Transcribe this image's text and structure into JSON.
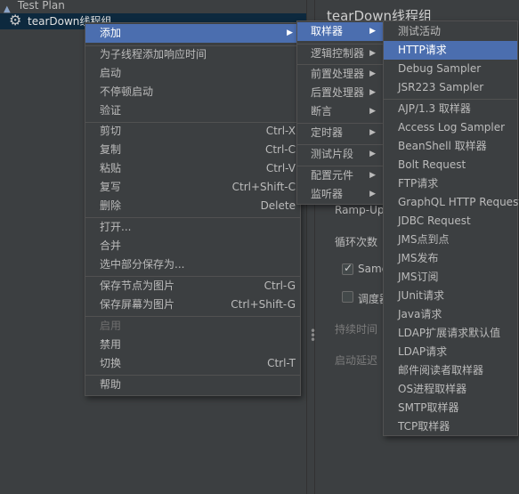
{
  "tree": {
    "test_plan": "Test Plan",
    "thread_group": "tearDown线程组"
  },
  "panel": {
    "title": "tearDown线程组",
    "ramp_up_label": "Ramp-Up",
    "loop_label": "循环次数",
    "same_user_label": "Same",
    "scheduler_label": "调度器",
    "duration_label": "持续时间",
    "startup_delay_label": "启动延迟"
  },
  "context_menu": {
    "add": "添加",
    "add_think_time": "为子线程添加响应时间",
    "start": "启动",
    "start_no_pause": "不停顿启动",
    "validate": "验证",
    "cut": "剪切",
    "cut_shortcut": "Ctrl-X",
    "copy": "复制",
    "copy_shortcut": "Ctrl-C",
    "paste": "粘贴",
    "paste_shortcut": "Ctrl-V",
    "duplicate": "复写",
    "duplicate_shortcut": "Ctrl+Shift-C",
    "delete": "删除",
    "delete_shortcut": "Delete",
    "open": "打开...",
    "merge": "合并",
    "save_selection_as": "选中部分保存为...",
    "save_node_as_image": "保存节点为图片",
    "save_node_shortcut": "Ctrl-G",
    "save_screen_as_image": "保存屏幕为图片",
    "save_screen_shortcut": "Ctrl+Shift-G",
    "enable": "启用",
    "disable": "禁用",
    "toggle": "切换",
    "toggle_shortcut": "Ctrl-T",
    "help": "帮助"
  },
  "add_submenu": {
    "items": [
      "取样器",
      "逻辑控制器",
      "前置处理器",
      "后置处理器",
      "断言",
      "定时器",
      "测试片段",
      "配置元件",
      "监听器"
    ]
  },
  "sampler_submenu": {
    "items": [
      "测试活动",
      "HTTP请求",
      "Debug Sampler",
      "JSR223 Sampler",
      "AJP/1.3 取样器",
      "Access Log Sampler",
      "BeanShell 取样器",
      "Bolt Request",
      "FTP请求",
      "GraphQL HTTP Request",
      "JDBC Request",
      "JMS点到点",
      "JMS发布",
      "JMS订阅",
      "JUnit请求",
      "Java请求",
      "LDAP扩展请求默认值",
      "LDAP请求",
      "邮件阅读者取样器",
      "OS进程取样器",
      "SMTP取样器",
      "TCP取样器"
    ]
  }
}
